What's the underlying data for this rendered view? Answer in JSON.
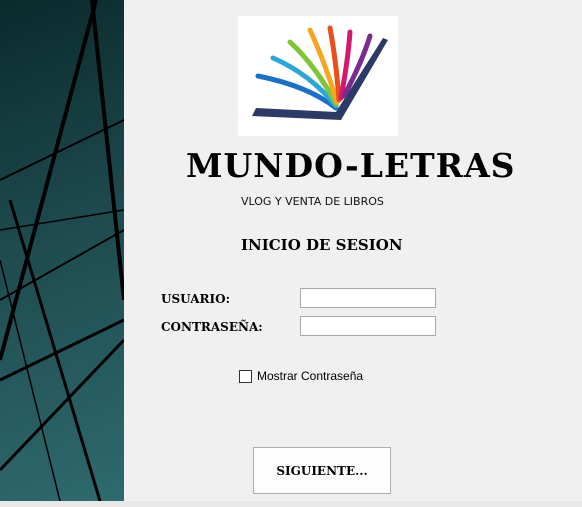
{
  "app": {
    "title": "MUNDO-LETRAS",
    "subtitle": "VLOG Y VENTA DE LIBROS"
  },
  "login": {
    "heading": "INICIO DE SESION",
    "username_label": "USUARIO:",
    "username_value": "",
    "password_label": "CONTRASEÑA:",
    "password_value": "",
    "show_password_label": "Mostrar Contraseña",
    "show_password_checked": false,
    "next_button_label": "SIGUIENTE..."
  },
  "colors": {
    "side_panel": "#1d4a4e",
    "background": "#f0f0f0",
    "book_cover": "#2b3a67"
  },
  "icons": {
    "logo": "book-rainbow-logo"
  }
}
